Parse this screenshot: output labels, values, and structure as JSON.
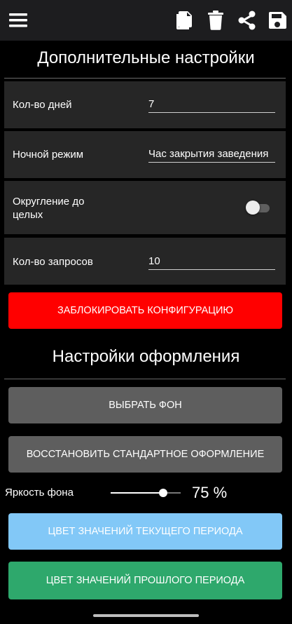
{
  "toolbar": {
    "icons": [
      "menu-icon",
      "copy-icon",
      "delete-icon",
      "share-icon",
      "save-icon"
    ],
    "icon_color": "#ffffff",
    "background": "#1d1d1f"
  },
  "advanced": {
    "title": "Дополнительные настройки",
    "days_label": "Кол-во дней",
    "days_value": "7",
    "night_label": "Ночной режим",
    "night_value": "Час закрытия заведения",
    "rounding_label_line1": "Округление до",
    "rounding_label_line2": "целых",
    "rounding_enabled": false,
    "requests_label": "Кол-во запросов",
    "requests_value": "10",
    "lock_button": "ЗАБЛОКИРОВАТЬ КОНФИГУРАЦИЮ"
  },
  "appearance": {
    "title": "Настройки оформления",
    "choose_bg_button": "ВЫБРАТЬ ФОН",
    "restore_button": "ВОССТАНОВИТЬ СТАНДАРТНОЕ ОФОРМЛЕНИЕ",
    "brightness_label": "Яркость фона",
    "brightness_percent": 75,
    "brightness_text": "75 %",
    "current_period_button": "ЦВЕТ ЗНАЧЕНИЙ ТЕКУЩЕГО ПЕРИОДА",
    "previous_period_button": "ЦВЕТ ЗНАЧЕНИЙ ПРОШЛОГО ПЕРИОДА"
  },
  "colors": {
    "lock_button": "#ff0000",
    "grey_button": "#5e5e5e",
    "current_period": "#82c8f7",
    "previous_period": "#2ea86c"
  }
}
